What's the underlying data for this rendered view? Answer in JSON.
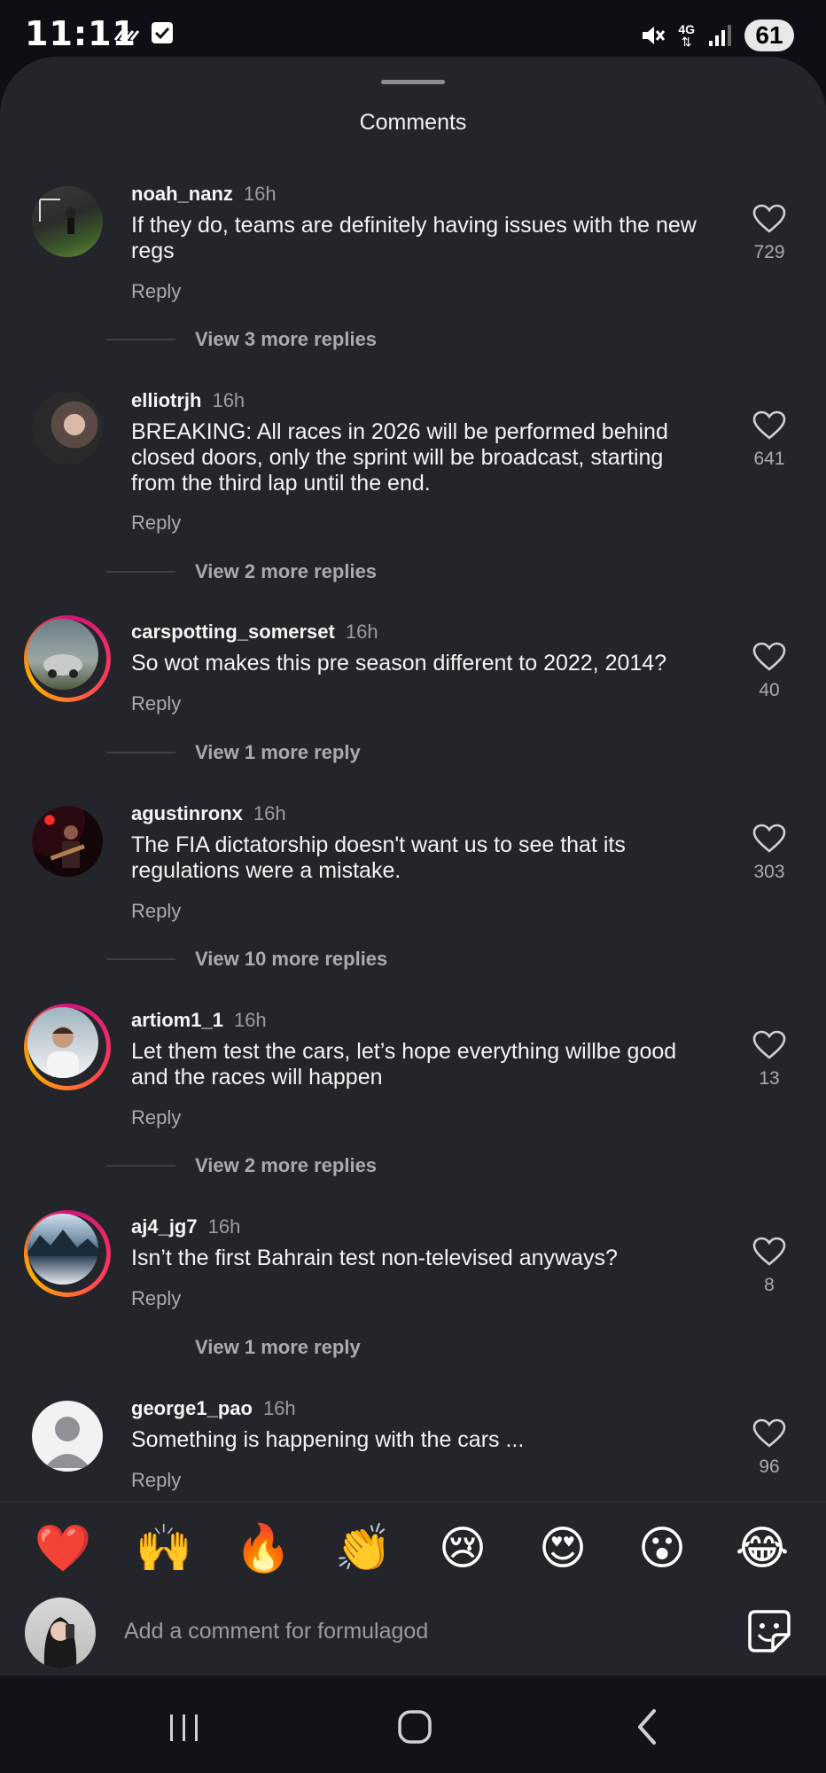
{
  "status_bar": {
    "time": "11:11",
    "network": "4G",
    "battery": "61"
  },
  "sheet": {
    "title": "Comments"
  },
  "comments": [
    {
      "username": "noah_nanz",
      "time": "16h",
      "text": "If they do, teams are definitely having issues with the new regs",
      "reply": "Reply",
      "likes": "729",
      "more": "View 3 more replies"
    },
    {
      "username": "elliotrjh",
      "time": "16h",
      "text": "BREAKING: All races in 2026 will be performed behind closed doors, only the sprint will be broadcast, starting from the third lap until the end.",
      "reply": "Reply",
      "likes": "641",
      "more": "View 2 more replies"
    },
    {
      "username": "carspotting_somerset",
      "time": "16h",
      "text": "So wot makes this pre season different to 2022, 2014?",
      "reply": "Reply",
      "likes": "40",
      "more": "View 1 more reply"
    },
    {
      "username": "agustinronx",
      "time": "16h",
      "text": "The FIA dictatorship doesn't want us to see that its regulations were a mistake.",
      "reply": "Reply",
      "likes": "303",
      "more": "View 10 more replies"
    },
    {
      "username": "artiom1_1",
      "time": "16h",
      "text": "Let them test the cars, let’s hope everything willbe good and the races will happen",
      "reply": "Reply",
      "likes": "13",
      "more": "View 2 more replies"
    },
    {
      "username": "aj4_jg7",
      "time": "16h",
      "text": "Isn’t the first Bahrain test non-televised anyways?",
      "reply": "Reply",
      "likes": "8",
      "more": "View 1 more reply"
    },
    {
      "username": "george1_pao",
      "time": "16h",
      "text": "Something is happening with the cars ...",
      "reply": "Reply",
      "likes": "96"
    }
  ],
  "emoji_bar": [
    "❤️",
    "🙌",
    "🔥",
    "👏",
    "😢",
    "😍",
    "😮",
    "😂"
  ],
  "composer": {
    "placeholder": "Add a comment for formulagod"
  },
  "colors": {
    "sheet_bg": "#23252b",
    "story_ring": [
      "#d1127b",
      "#ffb200"
    ],
    "heart_emoji": "#ff3355"
  }
}
